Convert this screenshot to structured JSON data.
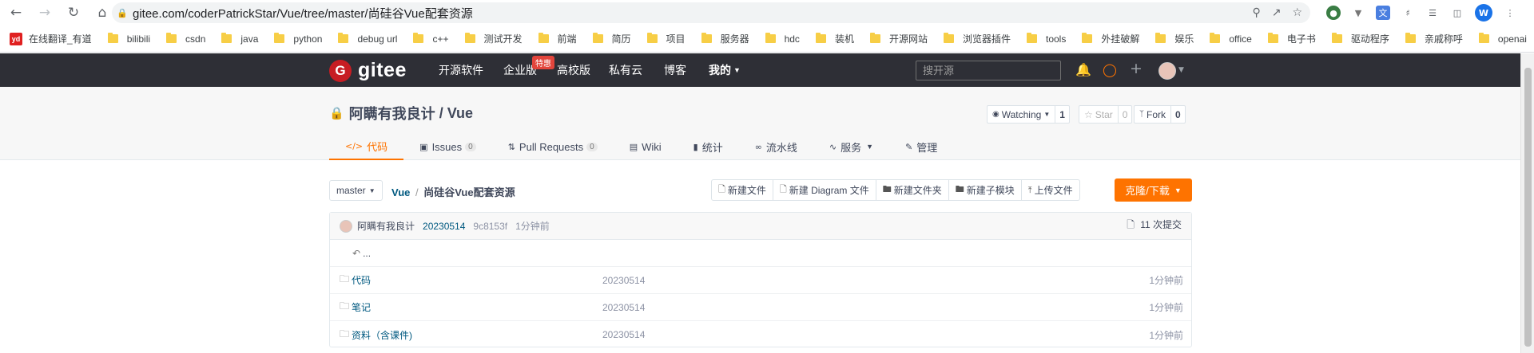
{
  "browser": {
    "url": "gitee.com/coderPatrickStar/Vue/tree/master/尚硅谷Vue配套资源",
    "extension_icons": [
      "user-profile-icon",
      "vertical-arrow-icon",
      "translate-icon",
      "puzzle-icon",
      "media-list-icon",
      "sidebar-icon"
    ],
    "profile_initial": "W"
  },
  "bookmarks": [
    {
      "label": "在线翻译_有道",
      "icon": "youdao"
    },
    {
      "label": "bilibili"
    },
    {
      "label": "csdn"
    },
    {
      "label": "java"
    },
    {
      "label": "python"
    },
    {
      "label": "debug url"
    },
    {
      "label": "c++"
    },
    {
      "label": "测试开发"
    },
    {
      "label": "前端"
    },
    {
      "label": "简历"
    },
    {
      "label": "项目"
    },
    {
      "label": "服务器"
    },
    {
      "label": "hdc"
    },
    {
      "label": "装机"
    },
    {
      "label": "开源网站"
    },
    {
      "label": "浏览器插件"
    },
    {
      "label": "tools"
    },
    {
      "label": "外挂破解"
    },
    {
      "label": "娱乐"
    },
    {
      "label": "office"
    },
    {
      "label": "电子书"
    },
    {
      "label": "驱动程序"
    },
    {
      "label": "亲戚称呼"
    },
    {
      "label": "openai"
    }
  ],
  "header": {
    "logo_mark": "G",
    "logo_text": "gitee",
    "nav": [
      "开源软件",
      "企业版",
      "高校版",
      "私有云",
      "博客",
      "我的"
    ],
    "hot_badge": "特惠",
    "search_placeholder": "搜开源"
  },
  "project": {
    "owner": "阿瞒有我良计",
    "separator": " / ",
    "name": "Vue",
    "watch_label": "Watching",
    "watch_count": "1",
    "star_label": "Star",
    "star_count": "0",
    "fork_label": "Fork",
    "fork_count": "0"
  },
  "tabs": [
    {
      "label": "代码",
      "icon": "</>"
    },
    {
      "label": "Issues",
      "count": "0"
    },
    {
      "label": "Pull Requests",
      "count": "0"
    },
    {
      "label": "Wiki"
    },
    {
      "label": "统计"
    },
    {
      "label": "流水线"
    },
    {
      "label": "服务"
    },
    {
      "label": "管理"
    }
  ],
  "repo": {
    "branch": "master",
    "crumb_root": "Vue",
    "crumb_sep": "/",
    "crumb_current": "尚硅谷Vue配套资源",
    "actions": [
      "新建文件",
      "新建 Diagram 文件",
      "新建文件夹",
      "新建子模块",
      "上传文件"
    ],
    "clone_label": "克隆/下载"
  },
  "commit": {
    "author": "阿瞒有我良计",
    "message": "20230514",
    "hash": "9c8153f",
    "time": "1分钟前",
    "commits_label": "11 次提交"
  },
  "files": [
    {
      "name": "...",
      "back": true
    },
    {
      "name": "代码",
      "message": "20230514",
      "time": "1分钟前"
    },
    {
      "name": "笔记",
      "message": "20230514",
      "time": "1分钟前"
    },
    {
      "name": "资料（含课件)",
      "message": "20230514",
      "time": "1分钟前"
    }
  ]
}
